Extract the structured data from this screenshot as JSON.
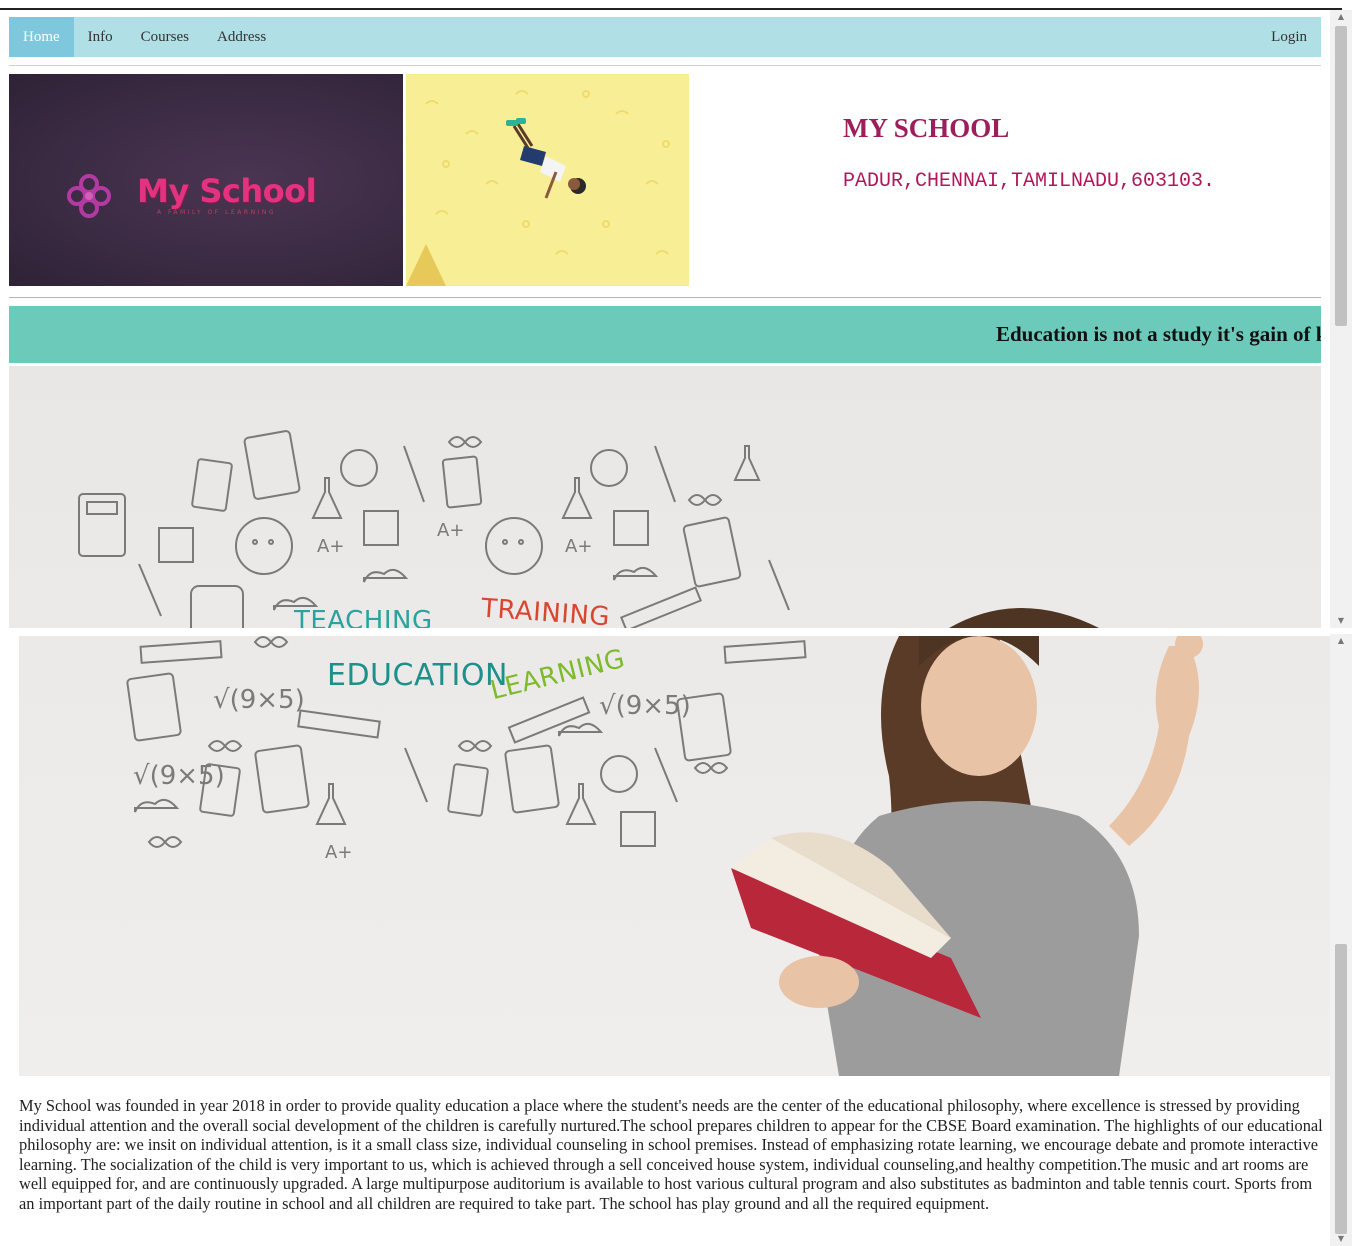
{
  "nav": {
    "items": [
      {
        "label": "Home",
        "active": true
      },
      {
        "label": "Info",
        "active": false
      },
      {
        "label": "Courses",
        "active": false
      },
      {
        "label": "Address",
        "active": false
      }
    ],
    "login_label": "Login"
  },
  "header": {
    "logo_text": "My School",
    "logo_tagline": "A FAMILY OF LEARNING",
    "school_name": "MY SCHOOL",
    "address": "PADUR,CHENNAI,TAMILNADU,603103."
  },
  "marquee": {
    "text": "Education is not a study it's gain of k"
  },
  "hero": {
    "words": {
      "teaching": "TEACHING",
      "training": "TRAINING",
      "education": "EDUCATION",
      "learning": "LEARNING"
    }
  },
  "about": {
    "text": "My School was founded in year 2018 in order to provide quality education a place where the student's needs are the center of the educational philosophy, where excellence is stressed by providing individual attention and the overall social development of the children is carefully nurtured.The school prepares children to appear for the CBSE Board examination. The highlights of our educational philosophy are: we insit on individual attention, is it a small class size, individual counseling in school premises. Instead of emphasizing rotate learning, we encourage debate and promote interactive learning. The socialization of the child is very important to us, which is achieved through a sell conceived house system, individual counseling,and healthy competition.The music and art rooms are well equipped for, and are continuously upgraded. A large multipurpose auditorium is available to host various cultural program and also substitutes as badminton and table tennis court. Sports from an important part of the daily routine in school and all children are required to take part. The school has play ground and all the required equipment."
  },
  "colors": {
    "navbar": "#b0dfe5",
    "nav_active": "#7fc7dd",
    "marquee": "#6ccabb",
    "school_name": "#9c1f5c",
    "logo_pink": "#e3327f",
    "logo_bg": "#3a2a42",
    "dancer_bg": "#f8ee96"
  }
}
